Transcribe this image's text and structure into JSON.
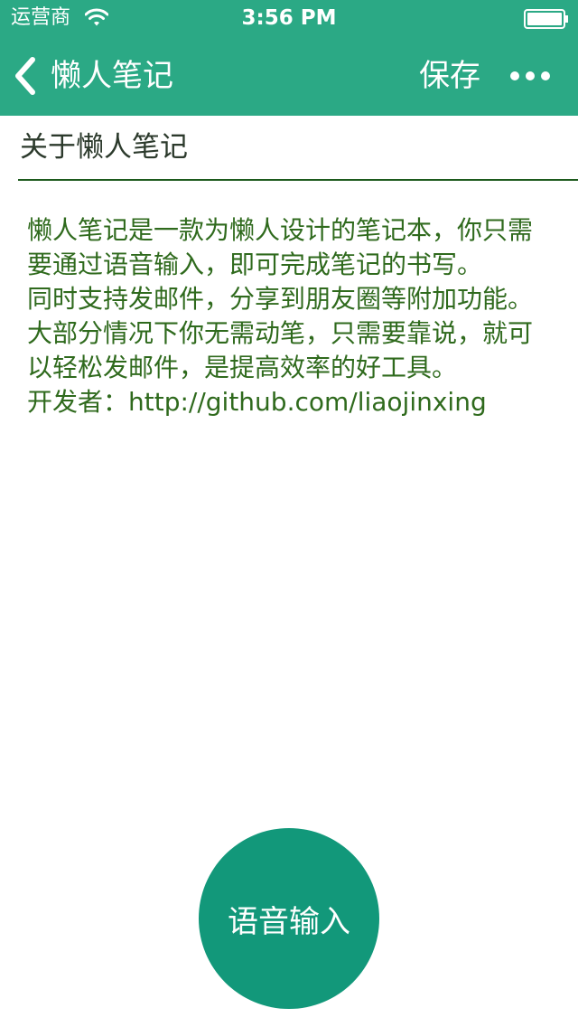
{
  "status_bar": {
    "carrier": "运营商",
    "time": "3:56 PM",
    "wifi_icon": "wifi-icon",
    "battery_icon": "battery-icon"
  },
  "nav": {
    "back_label": "懒人笔记",
    "back_icon": "chevron-left-icon",
    "save_label": "保存",
    "more_icon": "more-horizontal-icon"
  },
  "note": {
    "title": "关于懒人笔记",
    "body": "懒人笔记是一款为懒人设计的笔记本，你只需要通过语音输入，即可完成笔记的书写。\n同时支持发邮件，分享到朋友圈等附加功能。\n大部分情况下你无需动笔，只需要靠说，就可以轻松发邮件，是提高效率的好工具。\n开发者：http://github.com/liaojinxing"
  },
  "voice_button": {
    "label": "语音输入"
  },
  "colors": {
    "nav_background": "#2ba985",
    "body_text": "#2f6a1d",
    "divider": "#1d5a1d",
    "voice_button": "#12987a"
  }
}
